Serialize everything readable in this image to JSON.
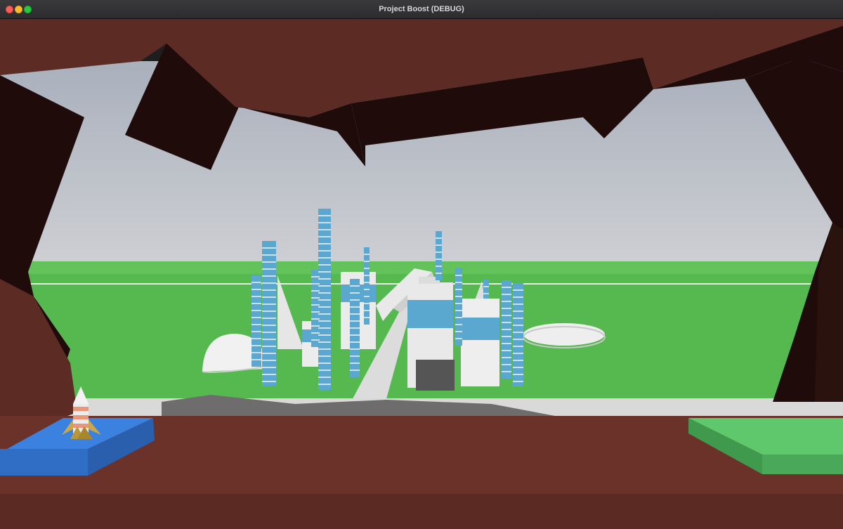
{
  "window": {
    "title": "Project Boost (DEBUG)",
    "controls": [
      "close",
      "minimize",
      "maximize"
    ]
  },
  "scene": {
    "description_objects": [
      "rocket",
      "launch-pad",
      "landing-pad",
      "cave-walls",
      "city-skyline",
      "dome",
      "disc-platform",
      "ground-plane",
      "sky"
    ],
    "colors": {
      "sky_top": "#a9b1bd",
      "sky_bottom": "#c9cbd0",
      "ground": "#56b94f",
      "cave_rock": "#5b2b24",
      "cave_shadow": "#1f0c0a",
      "launch_pad": "#3b82e0",
      "landing_pad": "#5fc76c",
      "tower_blue": "#5aa8d0",
      "building_white": "#e8e8e8"
    }
  }
}
